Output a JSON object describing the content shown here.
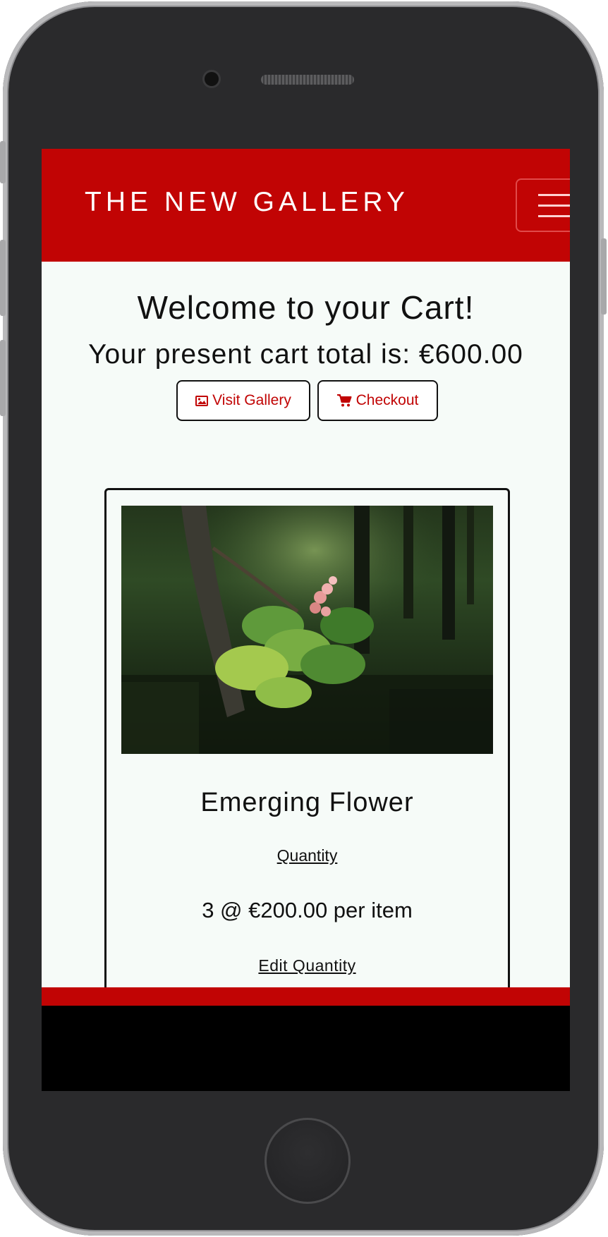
{
  "navbar": {
    "brand": "THE NEW GALLERY",
    "toggler_icon": "hamburger-menu-icon"
  },
  "cart": {
    "welcome": "Welcome to your Cart!",
    "total_text": "Your present cart total is: €600.00",
    "visit_gallery_label": "Visit Gallery",
    "visit_gallery_icon": "image-icon",
    "checkout_label": "Checkout",
    "checkout_icon": "shopping-cart-icon"
  },
  "items": [
    {
      "title": "Emerging Flower",
      "quantity_label": "Quantity",
      "price_line": "3 @ €200.00 per item",
      "edit_label": "Edit Quantity"
    }
  ],
  "colors": {
    "brand_red": "#c10404",
    "page_background": "#f6fbf8",
    "text": "#111111"
  }
}
